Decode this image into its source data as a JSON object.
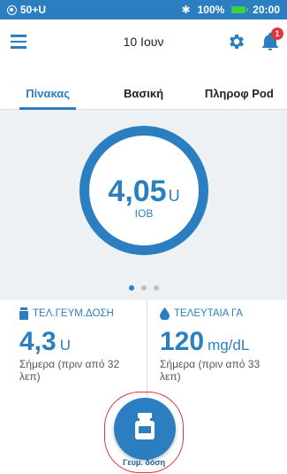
{
  "status_bar": {
    "pod_status": "50+U",
    "bluetooth": "✱",
    "battery_percent": "100%",
    "time": "20:00"
  },
  "header": {
    "date": "10 Ιουν",
    "notification_count": "1"
  },
  "tabs": [
    {
      "label": "Πίνακας",
      "active": true
    },
    {
      "label": "Βασική",
      "active": false
    },
    {
      "label": "Πληροφ Pod",
      "active": false
    }
  ],
  "iob": {
    "value": "4,05",
    "unit": "U",
    "label": "IOB"
  },
  "pager": {
    "pages": 3,
    "active_index": 0
  },
  "last_bolus": {
    "title": "ΤΕΛ.ΓΕΥΜ.ΔΟΣΗ",
    "value": "4,3",
    "unit": "U",
    "desc": "Σήμερα (πριν από 32 λεπ)"
  },
  "last_bg": {
    "title": "ΤΕΛΕΥΤΑΙΑ ΓΑ",
    "value": "120",
    "unit": "mg/dL",
    "desc": "Σήμερα (πριν από 33 λεπ)"
  },
  "bolus_button": {
    "label": "Γευμ. δόση"
  },
  "colors": {
    "accent": "#2b7fc0",
    "alert": "#e5353c",
    "battery": "#3ccd4a",
    "dashboard_bg": "#eef1f4"
  }
}
